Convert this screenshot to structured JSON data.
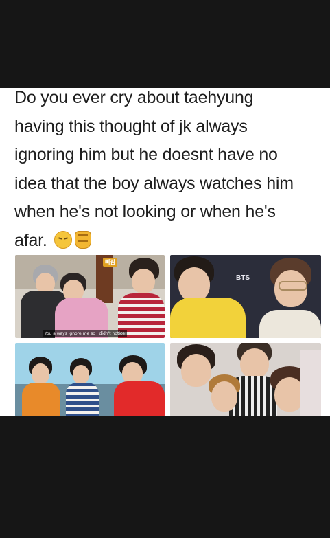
{
  "post": {
    "caption_lines": [
      "Do you ever cry about taehyung",
      "having this thought of jk always",
      "ignoring him but he doesnt have no",
      "idea that the boy always watches him",
      "when he's not looking or when he's",
      "afar."
    ],
    "emojis": [
      "pensive-face-icon",
      "raised-fist-icon"
    ]
  },
  "images": {
    "top_left": {
      "badge": "삐짐",
      "subtitle": "You always ignore me so I didn't notice"
    },
    "top_right": {
      "logo": "BTS"
    }
  },
  "colors": {
    "background": "#161616",
    "card": "#ffffff",
    "text": "#1e1e1e"
  }
}
